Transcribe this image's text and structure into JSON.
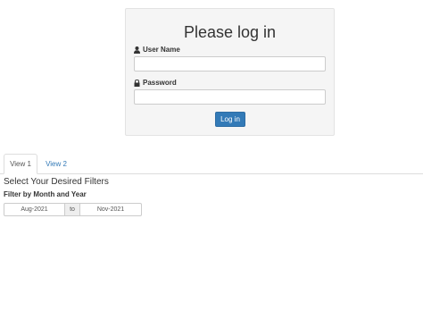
{
  "login": {
    "title": "Please log in",
    "username_label": "User Name",
    "username_value": "",
    "password_label": "Password",
    "password_value": "",
    "submit_label": "Log in"
  },
  "tabs": [
    {
      "label": "View 1",
      "active": true
    },
    {
      "label": "View 2",
      "active": false
    }
  ],
  "filters": {
    "heading": "Select Your Desired Filters",
    "month_year_label": "Filter by Month and Year",
    "range_start": "Aug-2021",
    "range_separator": "to",
    "range_end": "Nov-2021"
  },
  "colors": {
    "primary": "#337ab7",
    "panel_bg": "#f5f5f5"
  },
  "icons": {
    "username": "user-icon",
    "password": "lock-icon"
  }
}
